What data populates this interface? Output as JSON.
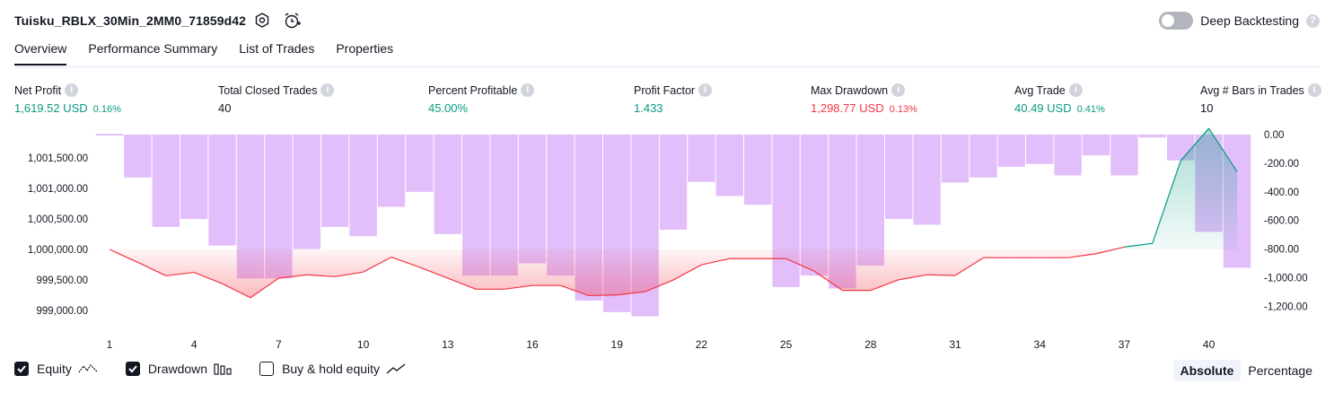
{
  "header": {
    "strategy_title": "Tuisku_RBLX_30Min_2MM0_71859d42",
    "settings_icon": "gear-icon",
    "alert_icon": "alarm-clock-plus-icon",
    "deep_backtesting_label": "Deep Backtesting",
    "deep_backtesting_enabled": false,
    "help_icon": "question-icon"
  },
  "tabs": [
    {
      "label": "Overview",
      "active": true
    },
    {
      "label": "Performance Summary",
      "active": false
    },
    {
      "label": "List of Trades",
      "active": false
    },
    {
      "label": "Properties",
      "active": false
    }
  ],
  "metrics": [
    {
      "label": "Net Profit",
      "value": "1,619.52 USD",
      "pct": "0.16%",
      "color": "green"
    },
    {
      "label": "Total Closed Trades",
      "value": "40",
      "pct": "",
      "color": "default"
    },
    {
      "label": "Percent Profitable",
      "value": "45.00%",
      "pct": "",
      "color": "green"
    },
    {
      "label": "Profit Factor",
      "value": "1.433",
      "pct": "",
      "color": "green"
    },
    {
      "label": "Max Drawdown",
      "value": "1,298.77 USD",
      "pct": "0.13%",
      "color": "red"
    },
    {
      "label": "Avg Trade",
      "value": "40.49 USD",
      "pct": "0.41%",
      "color": "green"
    },
    {
      "label": "Avg # Bars in Trades",
      "value": "10",
      "pct": "",
      "color": "default"
    }
  ],
  "chart_data": {
    "type": "line",
    "x": [
      1,
      2,
      3,
      4,
      5,
      6,
      7,
      8,
      9,
      10,
      11,
      12,
      13,
      14,
      15,
      16,
      17,
      18,
      19,
      20,
      21,
      22,
      23,
      24,
      25,
      26,
      27,
      28,
      29,
      30,
      31,
      32,
      33,
      34,
      35,
      36,
      37,
      38,
      39,
      40,
      41
    ],
    "x_ticks": [
      "1",
      "4",
      "7",
      "10",
      "13",
      "16",
      "19",
      "22",
      "25",
      "28",
      "31",
      "34",
      "37",
      "40"
    ],
    "left_axis_ticks": [
      "1,001,500.00",
      "1,001,000.00",
      "1,000,500.00",
      "1,000,000.00",
      "999,500.00",
      "999,000.00"
    ],
    "right_axis_ticks": [
      "0.00",
      "-200.00",
      "-400.00",
      "-600.00",
      "-800.00",
      "-1,000.00",
      "-1,200.00"
    ],
    "series": [
      {
        "name": "Equity",
        "axis": "left",
        "values": [
          1000000,
          999790,
          999570,
          999625,
          999440,
          999210,
          999530,
          999585,
          999555,
          999630,
          999875,
          999710,
          999530,
          999350,
          999350,
          999410,
          999410,
          999245,
          999255,
          999310,
          999500,
          999750,
          999850,
          999850,
          999850,
          999645,
          999330,
          999330,
          999505,
          999585,
          999575,
          999865,
          999865,
          999865,
          999865,
          999930,
          1000040,
          1000100,
          1001450,
          1001980,
          1001270
        ]
      },
      {
        "name": "Drawdown",
        "axis": "right",
        "values": [
          0,
          -300,
          -645,
          -590,
          -775,
          -1005,
          -1005,
          -800,
          -645,
          -710,
          -505,
          -400,
          -695,
          -985,
          -985,
          -900,
          -985,
          -1160,
          -1240,
          -1270,
          -665,
          -330,
          -430,
          -490,
          -1065,
          -985,
          -1075,
          -915,
          -590,
          -630,
          -335,
          -300,
          -225,
          -205,
          -285,
          -145,
          -285,
          -20,
          -180,
          -680,
          -930
        ]
      }
    ],
    "colors": {
      "equity": "#089981",
      "equity_dd": "#f23645",
      "drawdown": "#ce93f8"
    }
  },
  "legend": {
    "items": [
      {
        "label": "Equity",
        "checked": true,
        "icon": "line-zigzag-icon"
      },
      {
        "label": "Drawdown",
        "checked": true,
        "icon": "bar-chart-icon"
      },
      {
        "label": "Buy & hold equity",
        "checked": false,
        "icon": "trend-line-icon"
      }
    ],
    "mode_options": [
      "Absolute",
      "Percentage"
    ],
    "mode_selected": "Absolute"
  }
}
